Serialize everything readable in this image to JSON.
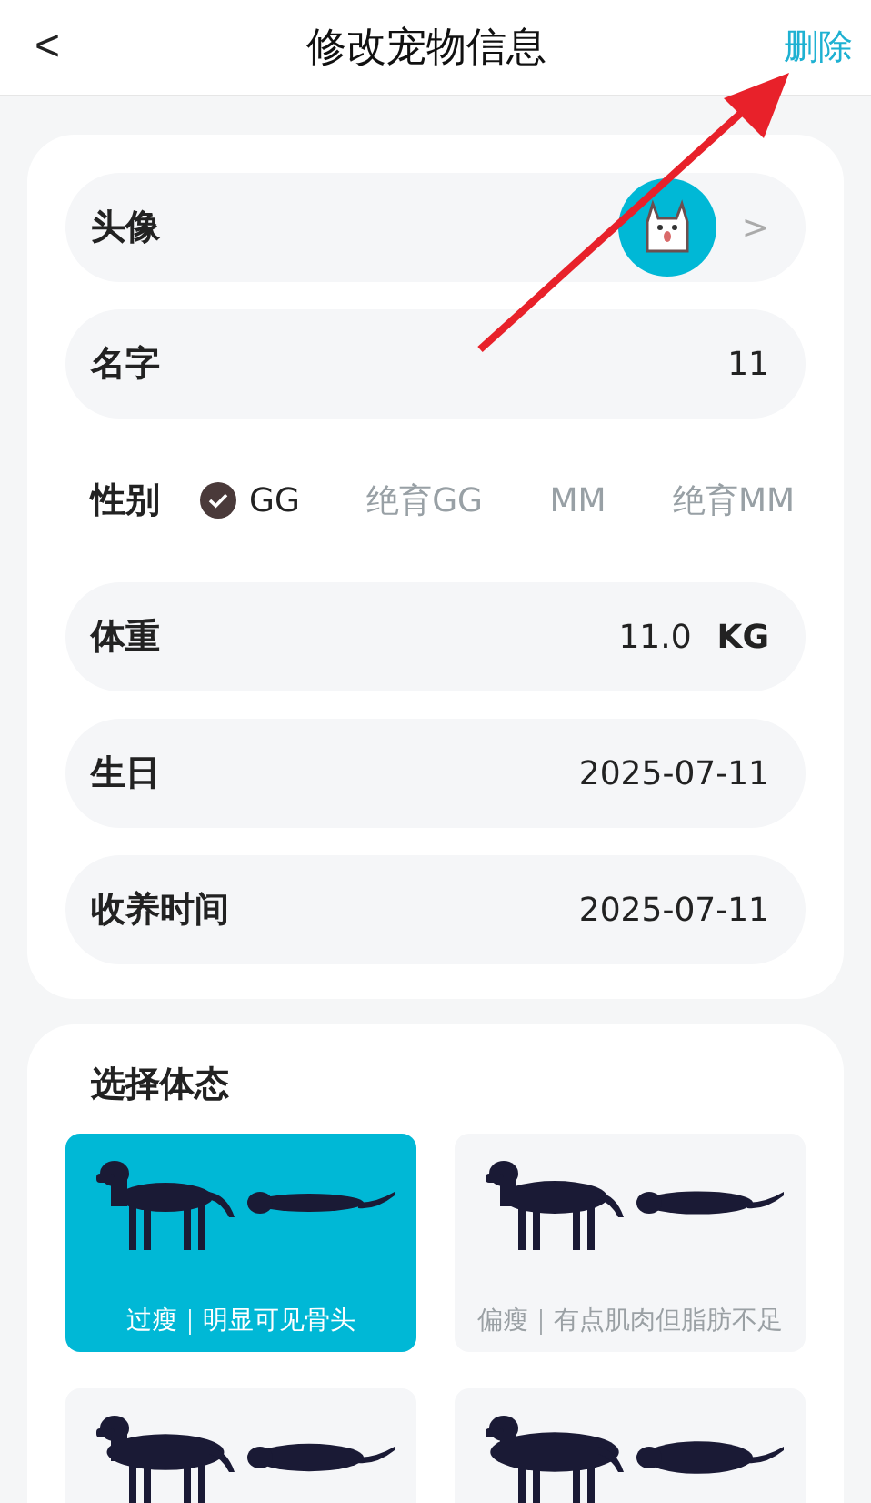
{
  "header": {
    "back": "<",
    "title": "修改宠物信息",
    "action": "删除"
  },
  "fields": [
    {
      "kind": "avatar",
      "label": "头像",
      "chevron": ">"
    },
    {
      "kind": "text",
      "label": "名字",
      "value": "11"
    },
    {
      "kind": "gender",
      "label": "性别",
      "options": [
        {
          "label": "GG",
          "selected": true
        },
        {
          "label": "绝育GG",
          "selected": false
        },
        {
          "label": "MM",
          "selected": false
        },
        {
          "label": "绝育MM",
          "selected": false
        }
      ]
    },
    {
      "kind": "text",
      "label": "体重",
      "value": "11.0",
      "unit": "KG"
    },
    {
      "kind": "text",
      "label": "生日",
      "value": "2025-07-11"
    },
    {
      "kind": "text",
      "label": "收养时间",
      "value": "2025-07-11"
    }
  ],
  "body_section": {
    "title": "选择体态",
    "options": [
      {
        "label": "过瘦｜明显可见骨头",
        "selected": true
      },
      {
        "label": "偏瘦｜有点肌肉但脂肪不足",
        "selected": false
      },
      {
        "selected": false
      },
      {
        "selected": false
      }
    ]
  }
}
